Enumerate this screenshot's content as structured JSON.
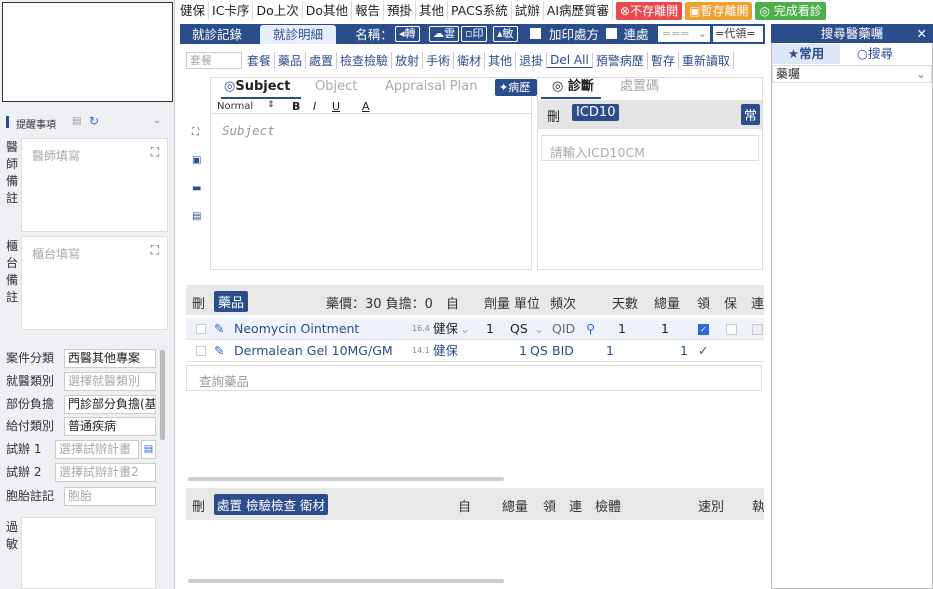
{
  "toolbar": {
    "items": [
      "健保",
      "IC卡序",
      "Do上次",
      "Do其他",
      "報告",
      "預掛",
      "其他",
      "PACS系統",
      "試辦",
      "AI病歷質審"
    ],
    "no_save_leave": "不存離開",
    "temp_save_leave": "暫存離開",
    "finish_visit": "完成看診"
  },
  "left": {
    "reminder_header": "提醒事項",
    "doctor_note_label": "醫師備註",
    "doctor_note_placeholder": "醫師填寫",
    "counter_note_label": "櫃台備註",
    "counter_note_placeholder": "櫃台填寫",
    "case_category_label": "案件分類",
    "case_category_value": "西醫其他專案",
    "visit_type_label": "就醫類別",
    "visit_type_placeholder": "選擇就醫類別",
    "copay_label": "部份負擔",
    "copay_value": "門診部分負擔(基",
    "payment_type_label": "給付類別",
    "payment_type_value": "普通疾病",
    "pilot1_label": "試辦 1",
    "pilot1_placeholder": "選擇試辦計畫",
    "pilot2_label": "試辦 2",
    "pilot2_placeholder": "選擇試辦計畫2",
    "fetal_label": "胞胎註記",
    "fetal_placeholder": "胞胎",
    "allergy_label": "過敏"
  },
  "tabs": {
    "visit_record": "就診記錄",
    "visit_detail": "就診明細",
    "name_label": "名稱：",
    "transfer": "轉",
    "cloud": "雲",
    "print": "印",
    "sensitive": "敏",
    "add_print_prescription": "加印處方",
    "continuous": "連處",
    "select_placeholder": "===",
    "code_input": "=代領="
  },
  "subtoolbar": {
    "search_placeholder": "套餐",
    "items": [
      "套餐",
      "藥品",
      "處置",
      "檢查檢驗",
      "放射",
      "手術",
      "衛材",
      "其他",
      "退掛",
      "Del All",
      "預警病歷",
      "暫存",
      "重新讀取"
    ]
  },
  "soap": {
    "tab_subject": "Subject",
    "tab_object": "Object",
    "tab_appraisal": "Appraisal Plan",
    "tab_history": "病歷",
    "font_normal": "Normal",
    "bold": "B",
    "italic": "I",
    "underline": "U",
    "color": "A",
    "subject_placeholder": "Subject"
  },
  "diagnosis": {
    "tab_diag": "診斷",
    "tab_proc_code": "處置碼",
    "delete_label": "刪",
    "icd_label": "ICD10",
    "common_label": "常",
    "icd_placeholder": "請輸入ICD10CM"
  },
  "drug_table": {
    "headers": {
      "delete": "刪",
      "drug": "藥品",
      "price": "藥價：30 負擔：0",
      "self": "自",
      "dose": "劑量",
      "unit": "單位",
      "freq": "頻次",
      "days": "天數",
      "total": "總量",
      "take": "領",
      "keep": "保",
      "cont": "連"
    },
    "rows": [
      {
        "name": "Neomycin Ointment",
        "price": "16.4",
        "pay": "健保",
        "dose": "1",
        "unit": "QS",
        "freq": "QID",
        "days": "1",
        "total": "1"
      },
      {
        "name": "Dermalean Gel 10MG/GM",
        "price": "14.1",
        "pay": "健保",
        "dose": "1",
        "unit": "QS",
        "freq": "BID",
        "days": "1",
        "total": "1"
      }
    ],
    "search_placeholder": "查詢藥品"
  },
  "bottom_table": {
    "delete": "刪",
    "tabs": [
      "處置",
      "檢驗檢查",
      "衛材"
    ],
    "self": "自",
    "total": "總量",
    "take": "領",
    "cont": "連",
    "specimen": "檢體",
    "speed": "速別",
    "exec": "執"
  },
  "right_panel": {
    "title": "搜尋醫藥囑",
    "tab_common": "常用",
    "tab_search": "搜尋",
    "select_value": "藥囑"
  },
  "colors": {
    "navy": "#2c4d8c",
    "red": "#e8494f",
    "orange": "#f0a030",
    "green": "#4cb04a"
  }
}
